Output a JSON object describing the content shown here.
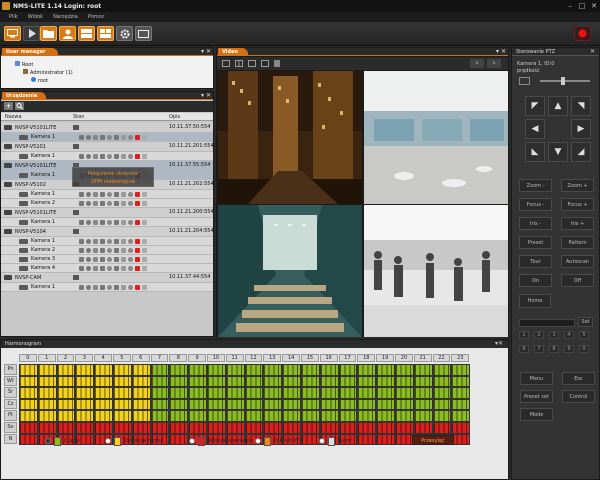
{
  "window": {
    "title": "NMS-LITE 1.14 Login: root",
    "min": "–",
    "max": "□",
    "close": "✕"
  },
  "menu": [
    "Plik",
    "Widok",
    "Narzędzia",
    "Pomoc"
  ],
  "user_manager": {
    "title": "User manager",
    "tree": {
      "root": "Root",
      "group": "Administrator (1)",
      "user": "root"
    }
  },
  "devices": {
    "title": "Urządzenia",
    "columns": {
      "name": "Nazwa",
      "status": "Stan",
      "addr": "Opis"
    },
    "rows": [
      {
        "kind": "device",
        "name": "NVSP-V5101LITE",
        "addr": "10.11.37.50:554",
        "sel": false
      },
      {
        "kind": "camera",
        "name": "Kamera 1",
        "addr": "",
        "sel": true
      },
      {
        "kind": "device",
        "name": "NVSP-V5101",
        "addr": "10.11.21.201:554",
        "sel": false
      },
      {
        "kind": "camera",
        "name": "Kamera 1",
        "addr": "",
        "sel": false
      },
      {
        "kind": "device",
        "name": "NVSP-V5101LITE",
        "addr": "10.11.37.55:554",
        "sel": true
      },
      {
        "kind": "camera",
        "name": "Kamera 1",
        "addr": "",
        "sel": true
      },
      {
        "kind": "device",
        "name": "NVSP-V5102",
        "addr": "10.11.21.202:554",
        "sel": false
      },
      {
        "kind": "camera",
        "name": "Kamera 1",
        "addr": "",
        "sel": false
      },
      {
        "kind": "camera",
        "name": "Kamera 2",
        "addr": "",
        "sel": false
      },
      {
        "kind": "device",
        "name": "NVSP-V5101LITE",
        "addr": "10.11.21.200:554",
        "sel": false
      },
      {
        "kind": "camera",
        "name": "Kamera 1",
        "addr": "",
        "sel": false
      },
      {
        "kind": "device",
        "name": "NVSP-V5104",
        "addr": "10.11.21.204:554",
        "sel": false
      },
      {
        "kind": "camera",
        "name": "Kamera 1",
        "addr": "",
        "sel": false
      },
      {
        "kind": "camera",
        "name": "Kamera 2",
        "addr": "",
        "sel": false
      },
      {
        "kind": "camera",
        "name": "Kamera 3",
        "addr": "",
        "sel": false
      },
      {
        "kind": "camera",
        "name": "Kamera 4",
        "addr": "",
        "sel": false
      },
      {
        "kind": "device",
        "name": "NVSP-CAM",
        "addr": "10.11.37.44:554",
        "sel": false
      },
      {
        "kind": "camera",
        "name": "Kamera 1",
        "addr": "",
        "sel": false
      }
    ],
    "overlay": {
      "line1": "Połączenie utracone",
      "line2": "DPM niedostępne"
    }
  },
  "video": {
    "title": "Video"
  },
  "ptz": {
    "title": "Sterowanie PTZ",
    "camera_label": "Kamera 1, ID:0",
    "speed_label": "prędkość",
    "buttons": [
      [
        "Zoom -",
        "Zoom +"
      ],
      [
        "Focus -",
        "Focus +"
      ],
      [
        "Iris -",
        "Iris +"
      ],
      [
        "Preset",
        "Pattern"
      ],
      [
        "Tour",
        "Autoscan"
      ],
      [
        "On",
        "Off"
      ]
    ],
    "home": "Home",
    "set_label": "Set",
    "numpad": [
      "1",
      "2",
      "3",
      "4",
      "5",
      "6",
      "7",
      "8",
      "9",
      "0"
    ],
    "bottom": [
      [
        "Menu",
        "Esc"
      ],
      [
        "Preset set",
        "Control"
      ],
      [
        "Mode",
        ""
      ]
    ]
  },
  "schedule": {
    "title": "Harmonogram",
    "hours": [
      "0",
      "1",
      "2",
      "3",
      "4",
      "5",
      "6",
      "7",
      "8",
      "9",
      "10",
      "11",
      "12",
      "13",
      "14",
      "15",
      "16",
      "17",
      "18",
      "19",
      "20",
      "21",
      "22",
      "23"
    ],
    "days": [
      "Pn",
      "Wt",
      "Śr",
      "Cz",
      "Pt",
      "So",
      "N"
    ],
    "rows": [
      "YYYYYYYGGGGGGGGGGGGGGGGG",
      "YYYYYYYGGGGGGGGGGGGGGGGG",
      "YYYYYYYGGGGGGGGGGGGGGGGG",
      "YYYYYYYGGGGGGGGGGGGGGGGG",
      "YYYYYYYGGGGGGGGGGGGGGGGG",
      "RRRRRRRRRRRRRRRRRRRRRRRR",
      "RRRRRRRRRRRRRRRRRRRRRRRR"
    ],
    "colors": {
      "G": "#8bbd22",
      "Y": "#f2d21a",
      "R": "#d8201e",
      "O": "#ee8a1c",
      "W": "#dddddd"
    },
    "legend": [
      {
        "key": "G",
        "label": "Ciągłe",
        "selected": true
      },
      {
        "key": "Y",
        "label": "Detekcja ruchu",
        "selected": false
      },
      {
        "key": "R",
        "label": "Wejście alarmowe",
        "selected": false
      },
      {
        "key": "O",
        "label": "D.R lub W.A",
        "selected": false
      },
      {
        "key": "W",
        "label": "Pusty",
        "selected": false
      }
    ],
    "apply": "Przesyłąć"
  }
}
